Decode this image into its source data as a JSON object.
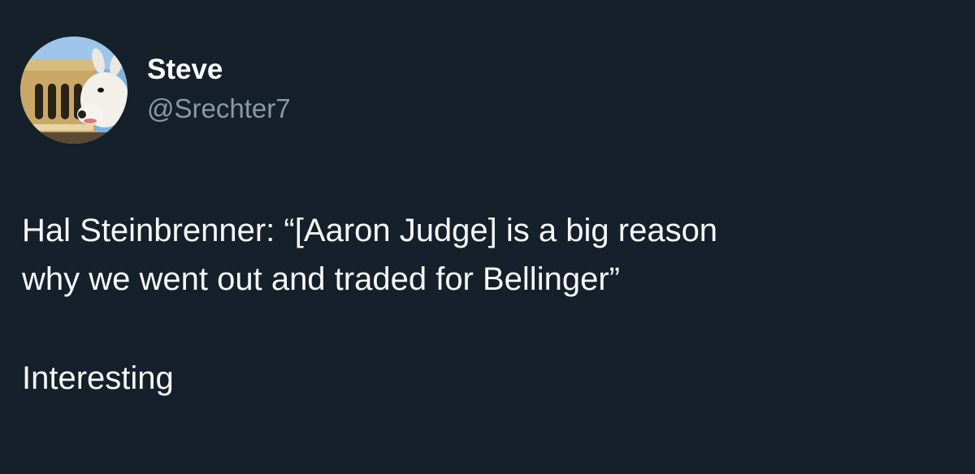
{
  "author": {
    "display_name": "Steve",
    "handle": "@Srechter7",
    "avatar_icon": "avatar-dog-stadium-icon"
  },
  "tweet": {
    "line1": "Hal Steinbrenner: “[Aaron Judge] is a big reason",
    "line2": "why we went out and traded for Bellinger”",
    "line3": "Interesting"
  },
  "colors": {
    "background": "#15202b",
    "name": "#ffffff",
    "handle": "#8b98a5",
    "text": "#f7f9f9"
  }
}
